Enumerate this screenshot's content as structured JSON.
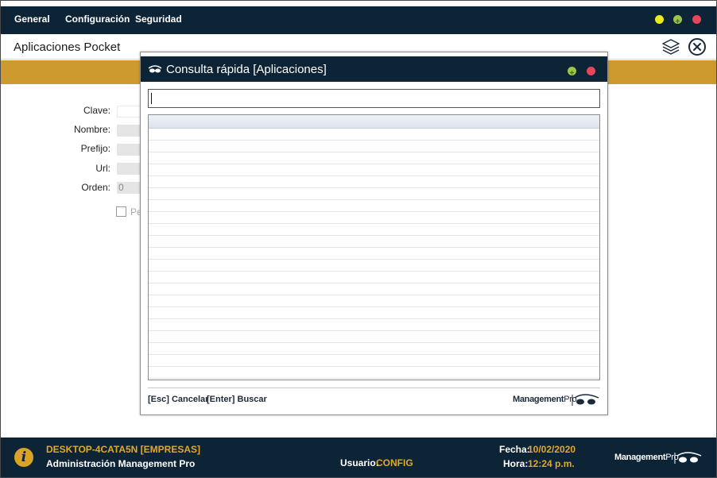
{
  "menu": {
    "items": [
      {
        "label": "General"
      },
      {
        "label": "Configuración"
      },
      {
        "label": "Seguridad"
      }
    ]
  },
  "window_controls": {
    "min_color": "#eaea1e",
    "max_color": "#9bc449",
    "close_color": "#e4475c"
  },
  "header": {
    "title": "Aplicaciones Pocket",
    "icons": [
      "layers-icon",
      "close-circle-icon"
    ]
  },
  "form": {
    "fields": [
      {
        "label": "Clave:",
        "value": ""
      },
      {
        "label": "Nombre:",
        "value": ""
      },
      {
        "label": "Prefijo:",
        "value": ""
      },
      {
        "label": "Url:",
        "value": ""
      },
      {
        "label": "Orden:",
        "value": "0"
      }
    ],
    "checkbox_label": "Pe"
  },
  "modal": {
    "title": "Consulta rápida [Aplicaciones]",
    "search": {
      "value": "",
      "placeholder": ""
    },
    "grid": {
      "columns": [
        ""
      ],
      "rows": []
    },
    "hints": [
      {
        "key": "[Esc]",
        "label": "Cancelar"
      },
      {
        "key": "[Enter]",
        "label": "Buscar"
      }
    ],
    "brand": {
      "name": "Management",
      "suffix": "Pro"
    }
  },
  "status": {
    "machine": "DESKTOP-4CATA5N [EMPRESAS]",
    "app_name": "Administración Management Pro",
    "user_label": "Usuario:",
    "user_value": "CONFIG",
    "date_label": "Fecha:",
    "date_value": "10/02/2020",
    "time_label": "Hora:",
    "time_value": "12:24 p.m.",
    "brand": {
      "name": "Management",
      "suffix": "Pro"
    }
  },
  "colors": {
    "navy": "#0d2336",
    "gold": "#cc9a2e",
    "status_gold": "#e0a92a"
  }
}
